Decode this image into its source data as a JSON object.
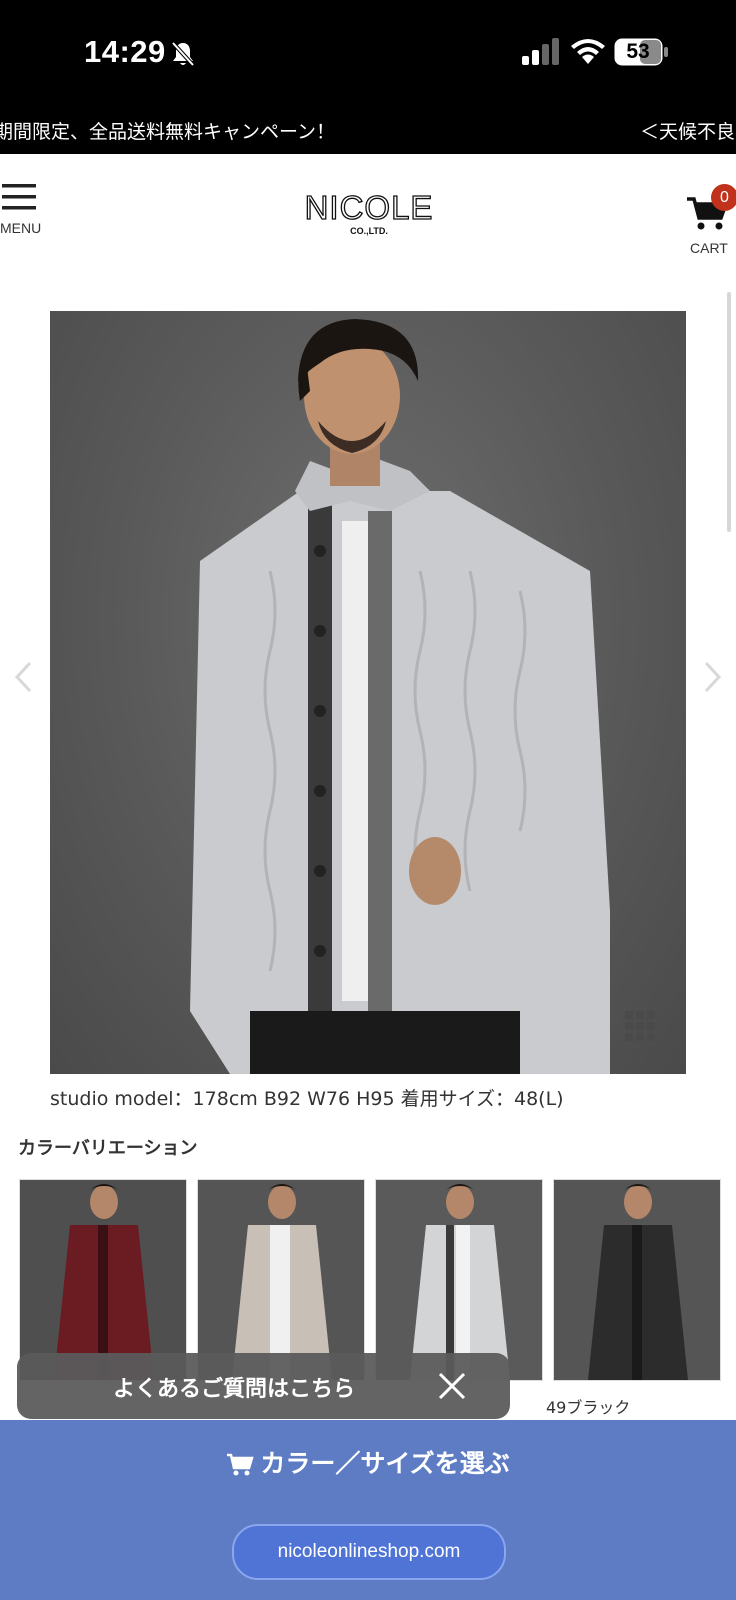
{
  "status_bar": {
    "time": "14:29",
    "battery": "53"
  },
  "marquee": {
    "text_1": "期間限定、全品送料無料キャンペーン！",
    "text_2": "＜天候不良に"
  },
  "header": {
    "menu_label": "MENU",
    "logo_text": "NICOLE",
    "logo_sub": "CO.,LTD.",
    "cart_label": "CART",
    "cart_count": "0"
  },
  "product": {
    "caption": "studio model：178cm B92 W76 H95 着用サイズ：48(L)"
  },
  "color_variation": {
    "title": "カラーバリエーション",
    "items": [
      {
        "label": "",
        "color": "#6b1c22"
      },
      {
        "label": "",
        "color": "#c8bfb6"
      },
      {
        "label": "",
        "color": "#d3d4d6"
      },
      {
        "label": "49ブラック",
        "color": "#2c2c2c"
      }
    ]
  },
  "faq_popup": {
    "text": "よくあるご質問はこちら"
  },
  "bottom_bar": {
    "select_label": "カラー／サイズを選ぶ",
    "url": "nicoleonlineshop.com"
  },
  "colors": {
    "accent_blue": "#5d7cc3",
    "badge_red": "#c0321b"
  },
  "icons": [
    "bell-slash-icon",
    "signal-icon",
    "wifi-icon",
    "battery-icon",
    "hamburger-menu-icon",
    "cart-icon",
    "chevron-left-icon",
    "chevron-right-icon",
    "grid-icon",
    "close-icon"
  ]
}
